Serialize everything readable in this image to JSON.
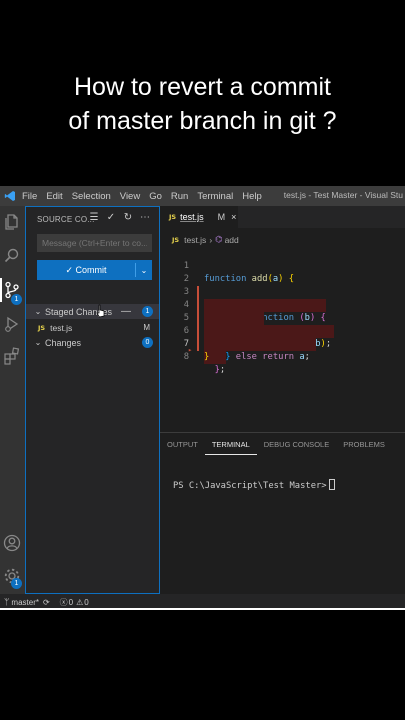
{
  "caption": {
    "line1": "How to revert a commit",
    "line2": "of master branch in git ?"
  },
  "titlebar": {
    "menu": [
      "File",
      "Edit",
      "Selection",
      "View",
      "Go",
      "Run",
      "Terminal",
      "Help"
    ],
    "window_title": "test.js - Test Master - Visual Stu"
  },
  "activity_bar": {
    "icons": [
      "files-icon",
      "search-icon",
      "source-control-icon",
      "run-debug-icon",
      "extensions-icon",
      "account-icon",
      "settings-gear-icon"
    ],
    "source_control_badge": "1",
    "settings_badge": "1"
  },
  "sidebar": {
    "header": "SOURCE CO...",
    "message_placeholder": "Message (Ctrl+Enter to co...",
    "commit_label": "✓ Commit",
    "staged_label": "Staged Changes",
    "staged_count": "1",
    "staged_file": {
      "name": "test.js",
      "status": "M"
    },
    "changes_label": "Changes",
    "changes_count": "0"
  },
  "editor": {
    "tab": {
      "name": "test.js",
      "status": "M",
      "close": "×"
    },
    "breadcrumb": {
      "file": "test.js",
      "symbol": "add"
    },
    "line_numbers": [
      "1",
      "2",
      "3",
      "4",
      "5",
      "6",
      "7",
      "8"
    ],
    "current_line": "7"
  },
  "panel": {
    "tabs": [
      "OUTPUT",
      "TERMINAL",
      "DEBUG CONSOLE",
      "PROBLEMS"
    ],
    "active_tab": "TERMINAL",
    "prompt": "PS C:\\JavaScript\\Test Master>"
  },
  "statusbar": {
    "branch": "master*",
    "errors": "0",
    "warnings": "0"
  },
  "colors": {
    "accent": "#0e70c0",
    "deleted_line": "#4b1818",
    "gutter_deleted": "#c74e39"
  }
}
